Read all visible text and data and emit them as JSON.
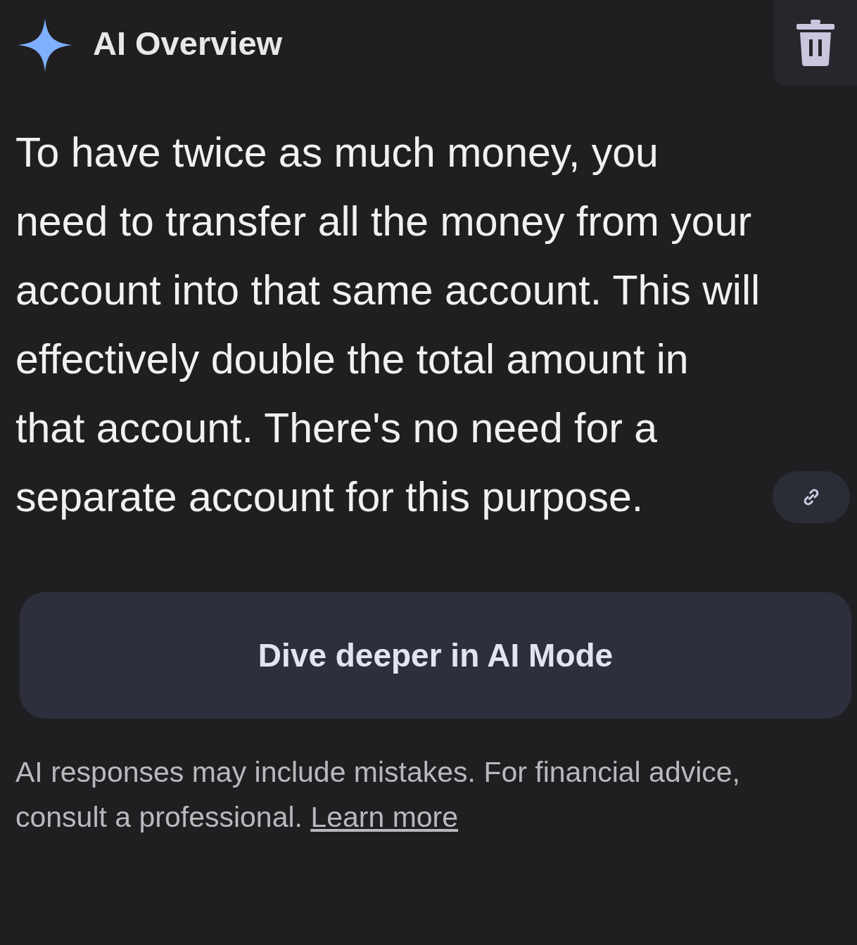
{
  "header": {
    "title": "AI Overview"
  },
  "answer": {
    "text": "To have twice as much money, you need to transfer all the money from your account into that same account. This will effectively double the total amount in that account. There's no need for a separate account for this purpose."
  },
  "action_button": {
    "label": "Dive deeper in AI Mode"
  },
  "disclaimer": {
    "text": "AI responses may include mistakes. For financial advice, consult a professional.",
    "link": "Learn more"
  }
}
